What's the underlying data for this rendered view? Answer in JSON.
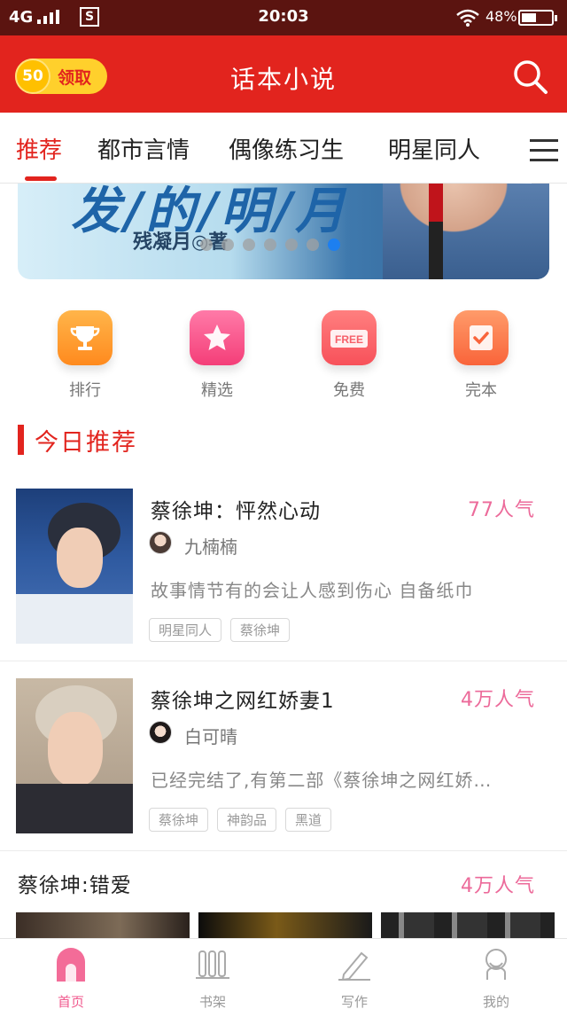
{
  "status_bar": {
    "network": "4G",
    "time": "20:03",
    "battery": "48%",
    "battery_level": 0.48,
    "app_icon": "S"
  },
  "header": {
    "coin_value": "50",
    "claim_label": "领取",
    "title": "话本小说",
    "search_icon": "search-icon"
  },
  "tabs": [
    "推荐",
    "都市言情",
    "偶像练习生",
    "明星同人"
  ],
  "active_tab": 0,
  "banner": {
    "title": "发/的/明/月",
    "author": "残凝月◎著",
    "slide_count": 7,
    "active_slide": 6
  },
  "quick_entries": [
    {
      "label": "排行",
      "icon": "trophy-icon",
      "color": "#ff9a2e"
    },
    {
      "label": "精选",
      "icon": "star-icon",
      "color": "#f44d82"
    },
    {
      "label": "免费",
      "icon": "free-tag-icon",
      "color": "#f6606a"
    },
    {
      "label": "完本",
      "icon": "check-note-icon",
      "color": "#fb7145"
    }
  ],
  "section_title": "今日推荐",
  "books": [
    {
      "title": "蔡徐坤：怦然心动",
      "popularity": "77人气",
      "author": "九楠楠",
      "description": "故事情节有的会让人感到伤心 自备纸巾",
      "tags": [
        "明星同人",
        "蔡徐坤"
      ]
    },
    {
      "title": "蔡徐坤之网红娇妻1",
      "popularity": "4万人气",
      "author": "白可晴",
      "description": "已经完结了,有第二部《蔡徐坤之网红娇…",
      "tags": [
        "蔡徐坤",
        "神韵品",
        "黑道"
      ]
    }
  ],
  "third_item": {
    "title": "蔡徐坤:错爱",
    "popularity": "4万人气"
  },
  "bottom_nav": [
    {
      "label": "首页",
      "icon": "home-icon"
    },
    {
      "label": "书架",
      "icon": "bookshelf-icon"
    },
    {
      "label": "写作",
      "icon": "pen-icon"
    },
    {
      "label": "我的",
      "icon": "profile-icon"
    }
  ],
  "active_nav": 0,
  "colors": {
    "brand_red": "#e2241e",
    "status_bar": "#5b1410",
    "popularity_pink": "#ec6a9a",
    "dot_active": "#1d7ff0",
    "coin_yellow": "#ffd02c"
  }
}
